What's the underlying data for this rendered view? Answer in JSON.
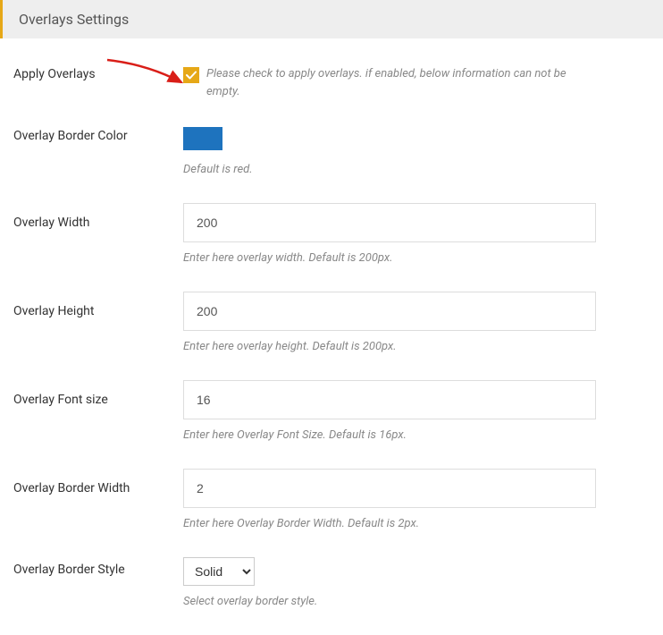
{
  "header": {
    "title": "Overlays Settings"
  },
  "fields": {
    "applyOverlays": {
      "label": "Apply Overlays",
      "help": "Please check to apply overlays. if enabled, below information can not be empty.",
      "checked": true
    },
    "borderColor": {
      "label": "Overlay Border Color",
      "color": "#1e73be",
      "help": "Default is red."
    },
    "width": {
      "label": "Overlay Width",
      "value": "200",
      "help": "Enter here overlay width. Default is 200px."
    },
    "height": {
      "label": "Overlay Height",
      "value": "200",
      "help": "Enter here overlay height. Default is 200px."
    },
    "fontSize": {
      "label": "Overlay Font size",
      "value": "16",
      "help": "Enter here Overlay Font Size. Default is 16px."
    },
    "borderWidth": {
      "label": "Overlay Border Width",
      "value": "2",
      "help": "Enter here Overlay Border Width. Default is 2px."
    },
    "borderStyle": {
      "label": "Overlay Border Style",
      "value": "Solid",
      "help": "Select overlay border style."
    }
  }
}
